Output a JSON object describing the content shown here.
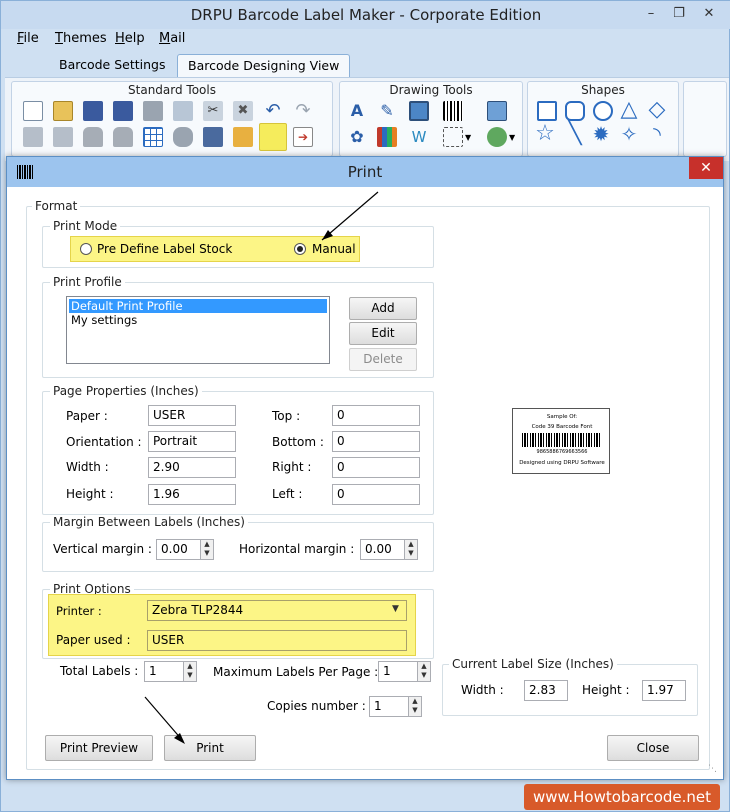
{
  "app": {
    "title": "DRPU Barcode Label Maker - Corporate Edition",
    "menu": [
      {
        "key": "F",
        "rest": "ile"
      },
      {
        "key": "T",
        "rest": "hemes"
      },
      {
        "key": "H",
        "rest": "elp"
      },
      {
        "key": "M",
        "rest": "ail"
      }
    ],
    "tabs": [
      "Barcode Settings",
      "Barcode Designing View"
    ],
    "toolbar_groups": [
      "Standard Tools",
      "Drawing Tools",
      "Shapes"
    ]
  },
  "dialog": {
    "title": "Print",
    "format_legend": "Format",
    "print_mode": {
      "legend": "Print Mode",
      "option_predefined": "Pre Define Label Stock",
      "option_manual": "Manual",
      "selected": "Manual"
    },
    "print_profile": {
      "legend": "Print Profile",
      "items": [
        "Default Print Profile",
        "My settings"
      ],
      "add_label": "Add",
      "edit_label": "Edit",
      "delete_label": "Delete"
    },
    "page_properties": {
      "legend": "Page Properties (Inches)",
      "paper_label": "Paper :",
      "paper_value": "USER",
      "orientation_label": "Orientation :",
      "orientation_value": "Portrait",
      "width_label": "Width :",
      "width_value": "2.90",
      "height_label": "Height :",
      "height_value": "1.96",
      "top_label": "Top :",
      "top_value": "0",
      "bottom_label": "Bottom :",
      "bottom_value": "0",
      "right_label": "Right :",
      "right_value": "0",
      "left_label": "Left :",
      "left_value": "0"
    },
    "margin": {
      "legend": "Margin Between Labels (Inches)",
      "vertical_label": "Vertical margin :",
      "vertical_value": "0.00",
      "horizontal_label": "Horizontal margin :",
      "horizontal_value": "0.00"
    },
    "print_options": {
      "legend": "Print Options",
      "printer_label": "Printer :",
      "printer_value": "Zebra TLP2844",
      "paper_used_label": "Paper used :",
      "paper_used_value": "USER"
    },
    "total_labels_label": "Total Labels :",
    "total_labels_value": "1",
    "max_per_page_label": "Maximum Labels Per Page :",
    "max_per_page_value": "1",
    "copies_label": "Copies number :",
    "copies_value": "1",
    "current_size": {
      "legend": "Current Label Size (Inches)",
      "width_label": "Width :",
      "width_value": "2.83",
      "height_label": "Height :",
      "height_value": "1.97"
    },
    "preview": {
      "line1": "Sample Of:",
      "line2": "Code 39 Barcode Font",
      "code": "9865886769663566",
      "line3": "Designed using DRPU Software"
    },
    "buttons": {
      "preview": "Print Preview",
      "print": "Print",
      "close": "Close"
    }
  },
  "watermark": "www.Howtobarcode.net"
}
